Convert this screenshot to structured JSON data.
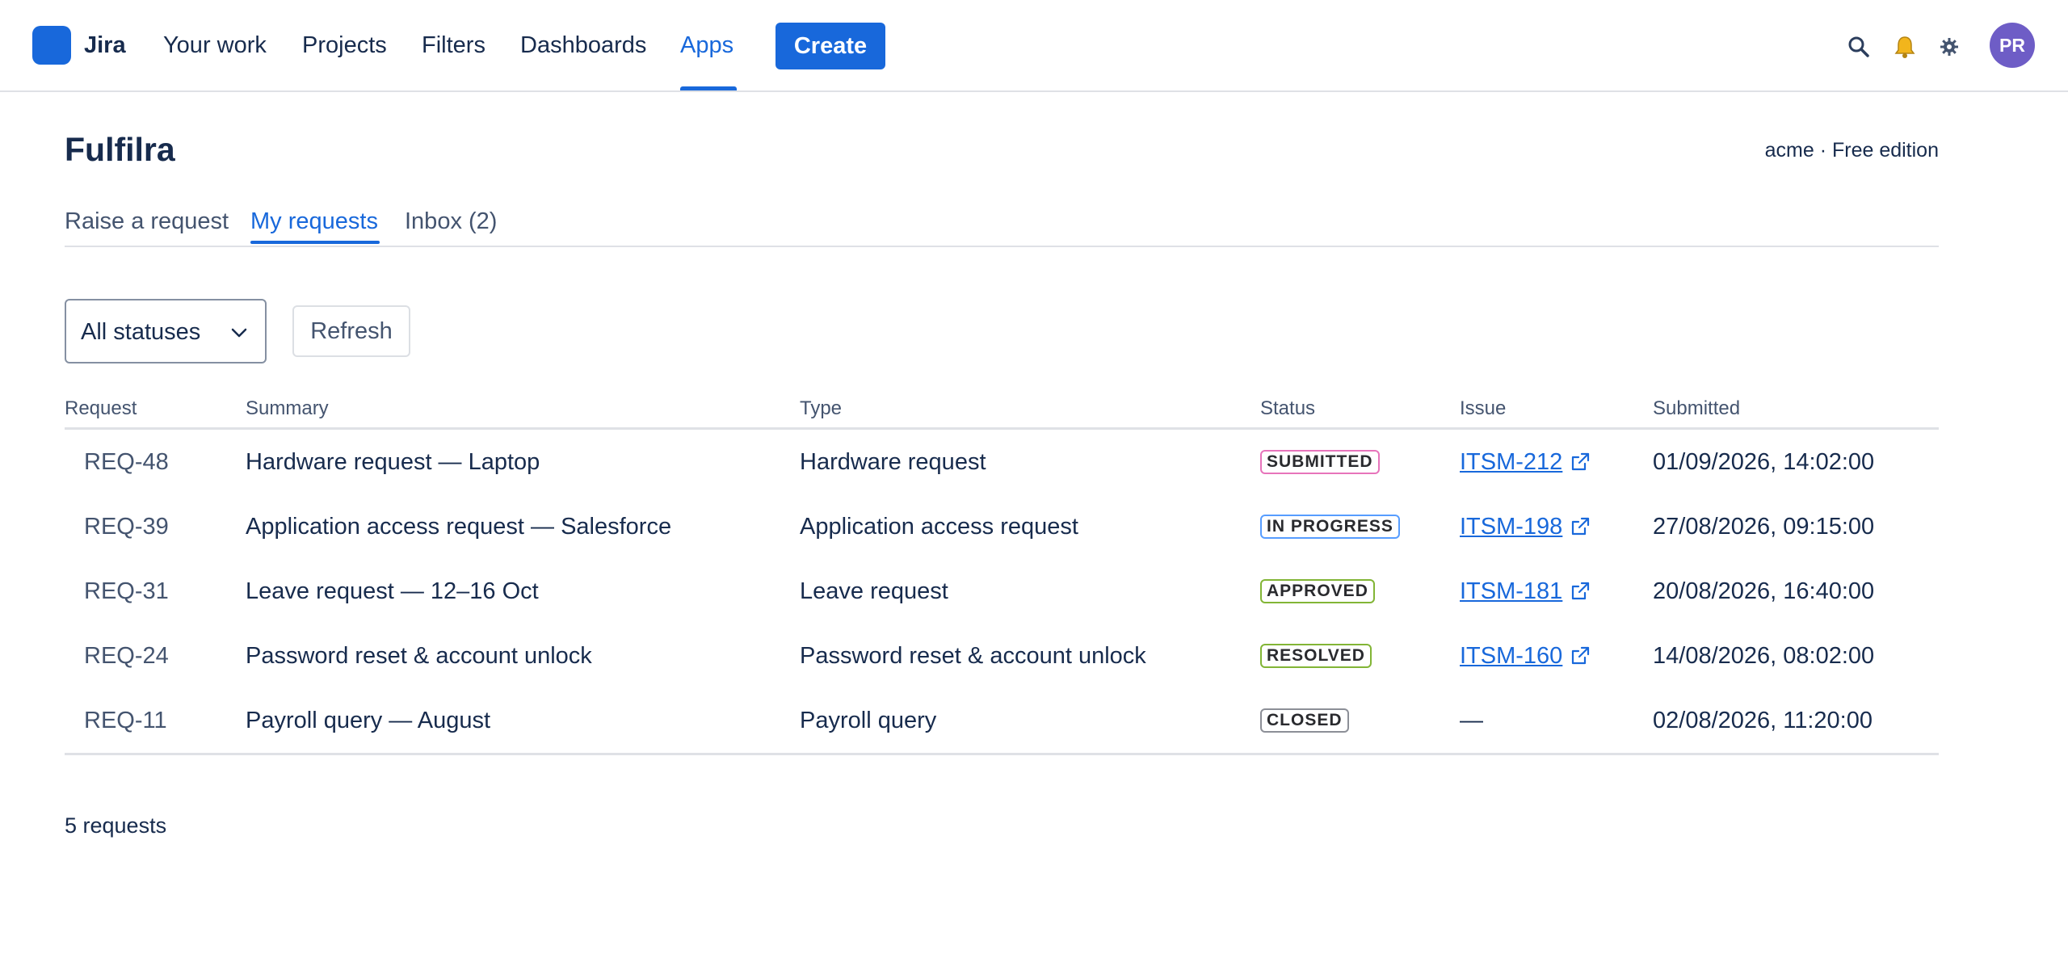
{
  "nav": {
    "logo": "Jira",
    "items": [
      "Your work",
      "Projects",
      "Filters",
      "Dashboards",
      "Apps"
    ],
    "active": "Apps",
    "create_label": "Create",
    "avatar_initials": "PR"
  },
  "page": {
    "title": "Fulfilra",
    "edition": "acme · Free edition"
  },
  "tabs": [
    {
      "label": "Raise a request"
    },
    {
      "label": "My requests"
    },
    {
      "label": "Inbox (2)"
    }
  ],
  "active_tab": "My requests",
  "filters": {
    "status_select": "All statuses",
    "refresh_label": "Refresh"
  },
  "table": {
    "headers": [
      "Request",
      "Summary",
      "Type",
      "Status",
      "Issue",
      "Submitted"
    ],
    "rows": [
      {
        "request": "REQ-48",
        "summary": "Hardware request — Laptop",
        "type": "Hardware request",
        "status": "SUBMITTED",
        "status_color": "#e774bb",
        "issue": "ITSM-212",
        "submitted": "01/09/2026, 14:02:00"
      },
      {
        "request": "REQ-39",
        "summary": "Application access request — Salesforce",
        "type": "Application access request",
        "status": "IN PROGRESS",
        "status_color": "#579dff",
        "issue": "ITSM-198",
        "submitted": "27/08/2026, 09:15:00"
      },
      {
        "request": "REQ-31",
        "summary": "Leave request — 12–16 Oct",
        "type": "Leave request",
        "status": "APPROVED",
        "status_color": "#82b536",
        "issue": "ITSM-181",
        "submitted": "20/08/2026, 16:40:00"
      },
      {
        "request": "REQ-24",
        "summary": "Password reset & account unlock",
        "type": "Password reset & account unlock",
        "status": "RESOLVED",
        "status_color": "#82b536",
        "issue": "ITSM-160",
        "submitted": "14/08/2026, 08:02:00"
      },
      {
        "request": "REQ-11",
        "summary": "Payroll query — August",
        "type": "Payroll query",
        "status": "CLOSED",
        "status_color": "#8c8f97",
        "issue": "—",
        "submitted": "02/08/2026, 11:20:00"
      }
    ]
  },
  "footer": {
    "count": "5 requests"
  },
  "colors": {
    "brand": "#1868db",
    "avatar": "#6e5dc6"
  },
  "icons": [
    "search-icon",
    "bell-icon",
    "gear-icon",
    "chevron-down-icon",
    "external-link-icon"
  ]
}
